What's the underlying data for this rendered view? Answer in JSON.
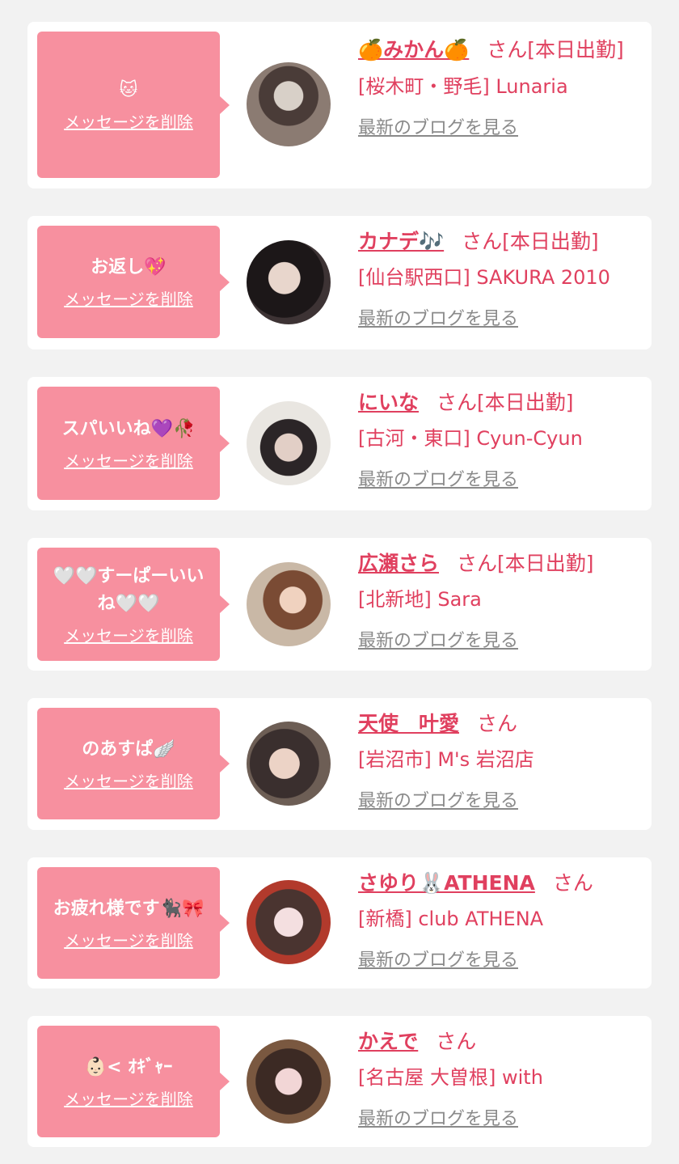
{
  "delete_label": "メッセージを削除",
  "blog_label": "最新のブログを見る",
  "colors": {
    "background": "#f2f2f2",
    "bubble": "#f7909f",
    "accent": "#e0405f",
    "link_gray": "#8a8a8a"
  },
  "entries": [
    {
      "message": "🐱",
      "name": "🍊みかん🍊",
      "san": "さん[本日出勤]",
      "shop": "[桜木町・野毛] Lunaria"
    },
    {
      "message": "お返し💖",
      "name": "カナデ🎶",
      "san": "さん[本日出勤]",
      "shop": "[仙台駅西口] SAKURA 2010"
    },
    {
      "message": "スパいいね💜🥀",
      "name": "にいな",
      "san": "さん[本日出勤]",
      "shop": "[古河・東口] Cyun-Cyun"
    },
    {
      "message": "🤍🤍すーぱーいいね🤍🤍",
      "name": "広瀬さら",
      "san": "さん[本日出勤]",
      "shop": "[北新地] Sara"
    },
    {
      "message": "のあすぱ🪽",
      "name": "天使　叶愛",
      "san": "さん",
      "shop": "[岩沼市] M's 岩沼店"
    },
    {
      "message": "お疲れ様です🐈‍⬛🎀",
      "name": "さゆり🐰ATHENA",
      "san": "さん",
      "shop": "[新橋] club ATHENA"
    },
    {
      "message": "👶🏻< ｵｷﾞｬｰ",
      "name": "かえで",
      "san": "さん",
      "shop": "[名古屋 大曽根] with"
    }
  ]
}
